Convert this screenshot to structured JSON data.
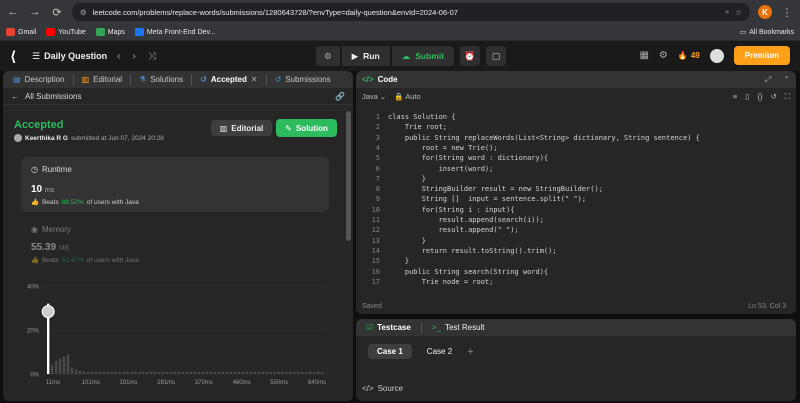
{
  "browser": {
    "url": "leetcode.com/problems/replace-words/submissions/1280643728/?envType=daily-question&envId=2024-06-07",
    "profile_initial": "K",
    "bookmarks": [
      {
        "label": "Gmail",
        "color": "#ea4335"
      },
      {
        "label": "YouTube",
        "color": "#ff0000"
      },
      {
        "label": "Maps",
        "color": "#34a853"
      },
      {
        "label": "Meta Front-End Dev...",
        "color": "#1877f2"
      }
    ],
    "all_bookmarks": "All Bookmarks"
  },
  "topbar": {
    "title": "Daily Question",
    "run": "Run",
    "submit": "Submit",
    "streak": "49",
    "premium": "Premium"
  },
  "left_tabs": [
    {
      "label": "Description",
      "icon": "description-icon"
    },
    {
      "label": "Editorial",
      "icon": "book-icon"
    },
    {
      "label": "Solutions",
      "icon": "flask-icon"
    },
    {
      "label": "Accepted",
      "icon": "history-icon",
      "active": true
    },
    {
      "label": "Submissions",
      "icon": "history-icon"
    }
  ],
  "submission": {
    "back_label": "All Submissions",
    "status": "Accepted",
    "author": "Keerthika R G",
    "submitted_at": "submitted at Jun 07, 2024 20:28",
    "editorial_btn": "Editorial",
    "solution_btn": "Solution",
    "runtime_label": "Runtime",
    "runtime_value": "10",
    "runtime_unit": "ms",
    "runtime_beats_pre": "Beats",
    "runtime_beats_pct": "88.52%",
    "runtime_beats_post": "of users with Java",
    "memory_label": "Memory",
    "memory_value": "55.39",
    "memory_unit": "MB",
    "memory_beats_pre": "Beats",
    "memory_beats_pct": "53.47%",
    "memory_beats_post": "of users with Java"
  },
  "chart_data": {
    "type": "bar",
    "y_ticks": [
      "40%",
      "20%",
      "0%"
    ],
    "ylim": [
      0,
      40
    ],
    "x_ticks": [
      "11ms",
      "101ms",
      "191ms",
      "281ms",
      "370ms",
      "460ms",
      "550ms",
      "640ms"
    ],
    "values": [
      32,
      4,
      6,
      7,
      8,
      9,
      3,
      2,
      1.5,
      1.2,
      1,
      1,
      1,
      1,
      1,
      1,
      1,
      1,
      1,
      1,
      1,
      1,
      1,
      1,
      1,
      1,
      1,
      1,
      1,
      1,
      1,
      1,
      1,
      1,
      1,
      1,
      1,
      1,
      1,
      1,
      1,
      1,
      1,
      1,
      1,
      1,
      1,
      1,
      1,
      1,
      1,
      1,
      1,
      1,
      1,
      1,
      1,
      1,
      1,
      1,
      1,
      1,
      1,
      1,
      1,
      1,
      1,
      1,
      1,
      1
    ],
    "highlight_index": 0,
    "highlight_color": "#ffffff",
    "bar_color": "#4a4a4a"
  },
  "code_panel": {
    "title": "Code",
    "language": "Java",
    "mode": "Auto",
    "saved": "Saved",
    "cursor": "Ln 53, Col 3",
    "lines": [
      "class Solution {",
      "    Trie root;",
      "    public String replaceWords(List<String> dictionary, String sentence) {",
      "        root = new Trie();",
      "        for(String word : dictionary){",
      "            insert(word);",
      "        }",
      "        StringBuilder result = new StringBuilder();",
      "        String []  input = sentence.split(\" \");",
      "        for(String i : input){",
      "            result.append(search(i));",
      "            result.append(\" \");",
      "        }",
      "        return result.toString().trim();",
      "    }",
      "    public String search(String word){",
      "        Trie node = root;"
    ]
  },
  "testcase_panel": {
    "tab_testcase": "Testcase",
    "tab_result": "Test Result",
    "cases": [
      "Case 1",
      "Case 2"
    ],
    "source": "Source"
  }
}
